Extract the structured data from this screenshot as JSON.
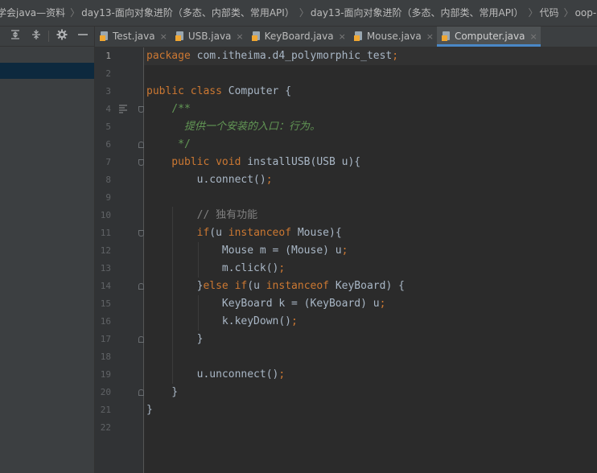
{
  "breadcrumb": [
    "学会java—资料",
    "day13-面向对象进阶（多态、内部类、常用API）",
    "day13-面向对象进阶（多态、内部类、常用API）",
    "代码",
    "oop-app"
  ],
  "breadcrumb_separator": "〉",
  "tabs": [
    {
      "label": "Test.java",
      "active": false
    },
    {
      "label": "USB.java",
      "active": false
    },
    {
      "label": "KeyBoard.java",
      "active": false
    },
    {
      "label": "Mouse.java",
      "active": false
    },
    {
      "label": "Computer.java",
      "active": true
    }
  ],
  "tab_close_glyph": "×",
  "toolbar_icons": [
    "expand-all-icon",
    "collapse-all-icon",
    "gear-icon",
    "minimize-icon"
  ],
  "editor": {
    "current_line": 1,
    "lines": [
      {
        "n": "1",
        "tokens": [
          {
            "t": "package ",
            "c": "kw"
          },
          {
            "t": "com.itheima.d4_polymorphic_test",
            "c": ""
          },
          {
            "t": ";",
            "c": "kw"
          }
        ]
      },
      {
        "n": "2",
        "tokens": []
      },
      {
        "n": "3",
        "tokens": [
          {
            "t": "public class ",
            "c": "kw"
          },
          {
            "t": "Computer {",
            "c": ""
          }
        ]
      },
      {
        "n": "4",
        "tokens": [
          {
            "t": "    /**",
            "c": "doc"
          }
        ]
      },
      {
        "n": "5",
        "tokens": [
          {
            "t": "      提供一个安装的入口：行为。",
            "c": "doci"
          }
        ]
      },
      {
        "n": "6",
        "tokens": [
          {
            "t": "     */",
            "c": "doc"
          }
        ]
      },
      {
        "n": "7",
        "tokens": [
          {
            "t": "    public void ",
            "c": "kw"
          },
          {
            "t": "installUSB(USB u){",
            "c": ""
          }
        ]
      },
      {
        "n": "8",
        "tokens": [
          {
            "t": "        u.connect()",
            "c": ""
          },
          {
            "t": ";",
            "c": "kw"
          }
        ]
      },
      {
        "n": "9",
        "tokens": []
      },
      {
        "n": "10",
        "tokens": [
          {
            "t": "        // 独有功能",
            "c": "cm"
          }
        ]
      },
      {
        "n": "11",
        "tokens": [
          {
            "t": "        ",
            "c": ""
          },
          {
            "t": "if",
            "c": "kw"
          },
          {
            "t": "(u ",
            "c": ""
          },
          {
            "t": "instanceof ",
            "c": "kw"
          },
          {
            "t": "Mouse){",
            "c": ""
          }
        ]
      },
      {
        "n": "12",
        "tokens": [
          {
            "t": "            Mouse m = (Mouse) u",
            "c": ""
          },
          {
            "t": ";",
            "c": "kw"
          }
        ]
      },
      {
        "n": "13",
        "tokens": [
          {
            "t": "            m.click()",
            "c": ""
          },
          {
            "t": ";",
            "c": "kw"
          }
        ]
      },
      {
        "n": "14",
        "tokens": [
          {
            "t": "        }",
            "c": ""
          },
          {
            "t": "else if",
            "c": "kw"
          },
          {
            "t": "(u ",
            "c": ""
          },
          {
            "t": "instanceof ",
            "c": "kw"
          },
          {
            "t": "KeyBoard) {",
            "c": ""
          }
        ]
      },
      {
        "n": "15",
        "tokens": [
          {
            "t": "            KeyBoard k = (KeyBoard) u",
            "c": ""
          },
          {
            "t": ";",
            "c": "kw"
          }
        ]
      },
      {
        "n": "16",
        "tokens": [
          {
            "t": "            k.keyDown()",
            "c": ""
          },
          {
            "t": ";",
            "c": "kw"
          }
        ]
      },
      {
        "n": "17",
        "tokens": [
          {
            "t": "        }",
            "c": ""
          }
        ]
      },
      {
        "n": "18",
        "tokens": []
      },
      {
        "n": "19",
        "tokens": [
          {
            "t": "        u.unconnect()",
            "c": ""
          },
          {
            "t": ";",
            "c": "kw"
          }
        ]
      },
      {
        "n": "20",
        "tokens": [
          {
            "t": "    }",
            "c": ""
          }
        ]
      },
      {
        "n": "21",
        "tokens": [
          {
            "t": "}",
            "c": ""
          }
        ]
      },
      {
        "n": "22",
        "tokens": []
      }
    ]
  },
  "colors": {
    "keyword": "#cc7832",
    "text": "#a9b7c6",
    "comment": "#808080",
    "doc_comment": "#629755",
    "editor_bg": "#2b2b2b",
    "gutter_bg": "#313335",
    "active_tab_underline": "#4a88c7"
  }
}
